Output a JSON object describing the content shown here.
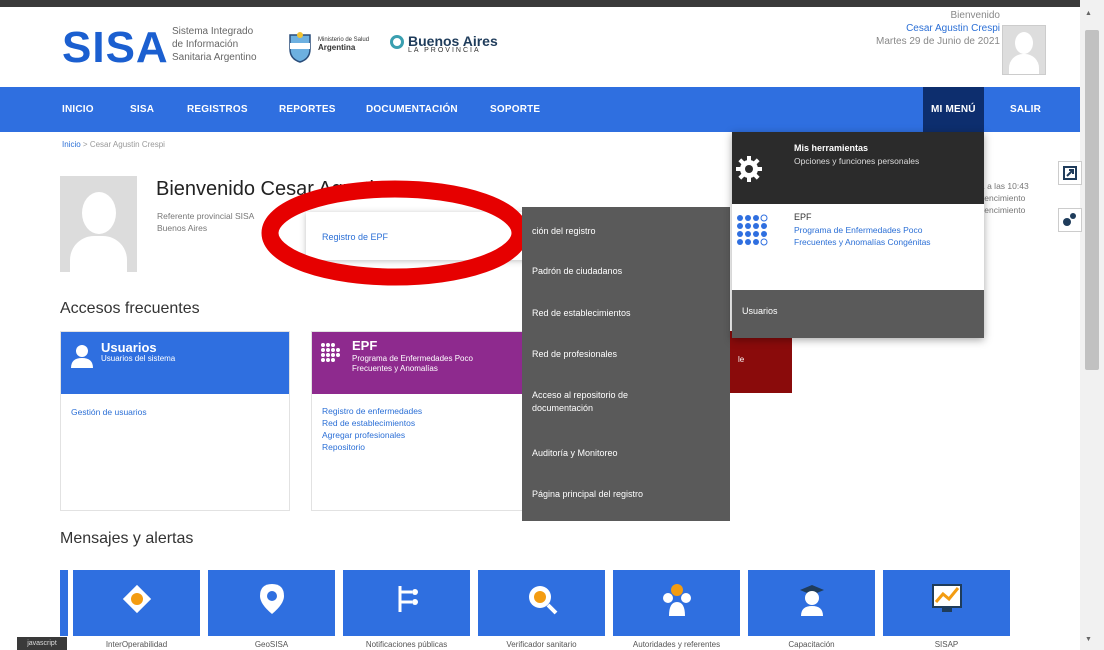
{
  "header": {
    "logo_text": "SISA",
    "logo_sub": [
      "Sistema Integrado",
      "de Información",
      "Sanitaria Argentino"
    ],
    "ministry_small": "Ministerio de Salud",
    "ministry_country": "Argentina",
    "ba_name": "Buenos Aires",
    "ba_sub": "LA PROVINCIA",
    "greeting": "Bienvenido",
    "user_name": "Cesar Agustin Crespi",
    "date": "Martes 29 de Junio de 2021"
  },
  "nav": {
    "items": [
      "INICIO",
      "SISA",
      "REGISTROS",
      "REPORTES",
      "DOCUMENTACIÓN",
      "SOPORTE"
    ],
    "mi_menu": "MI MENÚ",
    "salir": "SALIR"
  },
  "breadcrumb": {
    "home": "Inicio",
    "sep": " > ",
    "current": "Cesar Agustin Crespi"
  },
  "profile": {
    "welcome": "Bienvenido Cesar Agustin",
    "role_line1": "Referente provincial SISA",
    "role_line2": "Buenos Aires",
    "meta_line1": "1 a las 10:43",
    "meta_line2": "vencimiento",
    "meta_line3": "vencimiento"
  },
  "sub_popup": {
    "link": "Registro de EPF"
  },
  "accesos": {
    "title": "Accesos frecuentes",
    "usuarios": {
      "title": "Usuarios",
      "subtitle": "Usuarios del sistema",
      "links": [
        "Gestión de usuarios"
      ]
    },
    "epf": {
      "title": "EPF",
      "subtitle": "Programa de Enfermedades Poco Frecuentes y Anomalías",
      "links": [
        "Registro de enfermedades",
        "Red de establecimientos",
        "Agregar profesionales",
        "Repositorio"
      ]
    },
    "third_label": "le"
  },
  "dropdown": {
    "items": [
      "ción del registro",
      "Padrón de ciudadanos",
      "Red de establecimientos",
      "Red de profesionales",
      "Acceso al repositorio de documentación",
      "Auditoría y Monitoreo",
      "Página principal del registro"
    ]
  },
  "mi_menu_panel": {
    "tools_title": "Mis herramientas",
    "tools_desc": "Opciones y funciones personales",
    "epf_title": "EPF",
    "epf_desc": "Programa de Enfermedades Poco Frecuentes y Anomalías Congénitas",
    "users": "Usuarios"
  },
  "mensajes": {
    "title": "Mensajes y alertas",
    "tiles": [
      "InterOperabilidad",
      "GeoSISA",
      "Notificaciones públicas",
      "Verificador sanitario",
      "Autoridades y referentes",
      "Capacitación",
      "SISAP"
    ]
  },
  "cookie_tag": "javascript",
  "colors": {
    "brand_blue": "#2f6fe0",
    "nav_dark": "#0d2e6e",
    "epf_purple": "#8e2a8e",
    "dropdown_gray": "#5a5a5a",
    "highlight_red": "#e60000"
  }
}
